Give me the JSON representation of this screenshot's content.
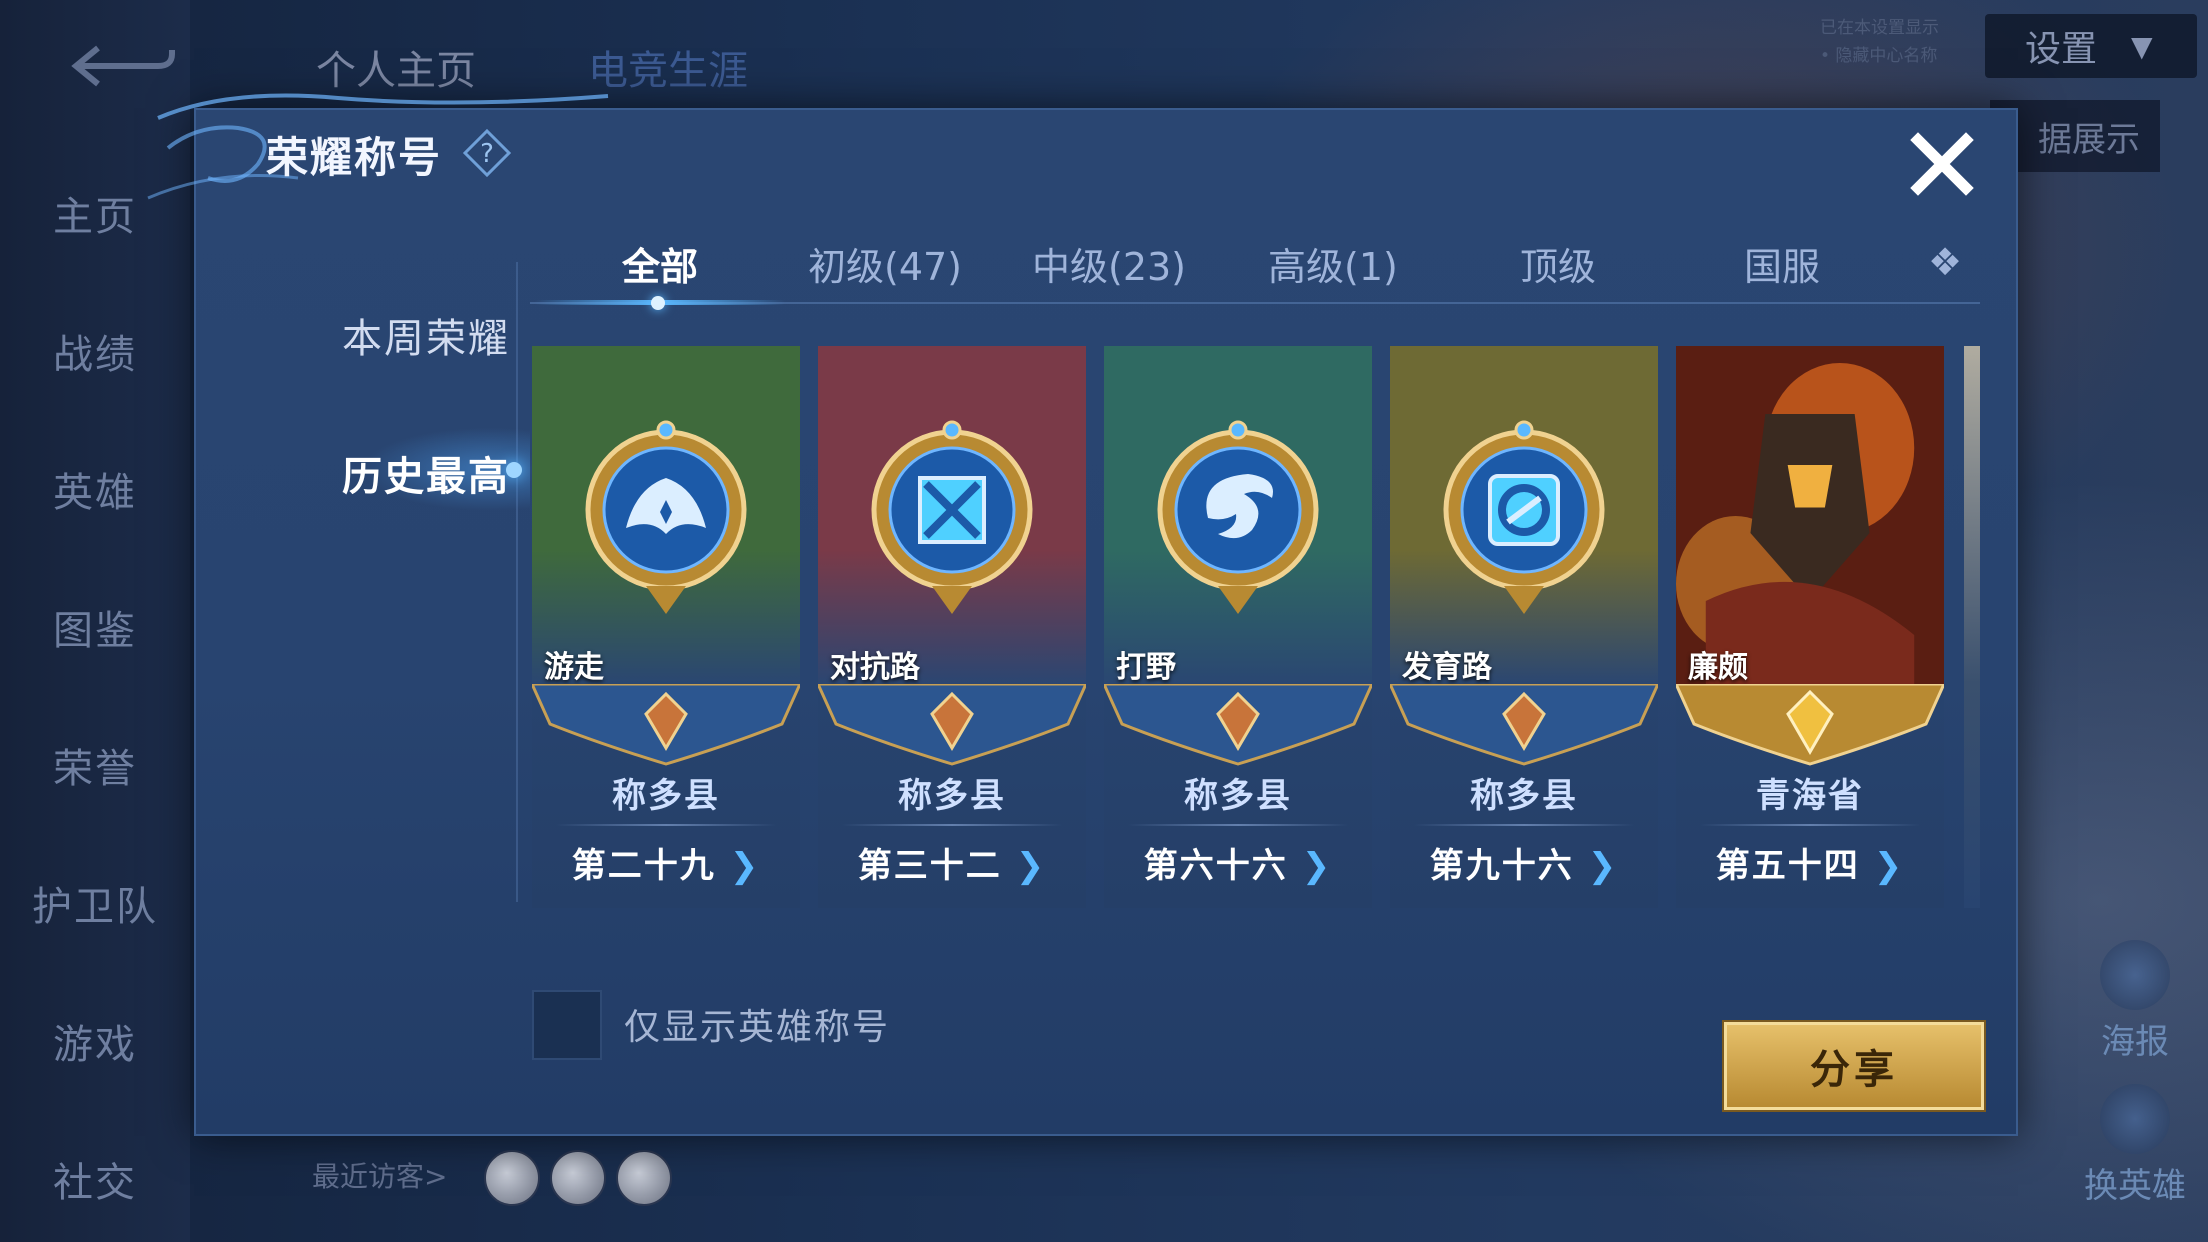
{
  "background": {
    "nav_items": [
      "主页",
      "战绩",
      "英雄",
      "图鉴",
      "荣誉",
      "护卫队",
      "游戏",
      "社交"
    ],
    "top_tabs": [
      "个人主页",
      "电竞生涯"
    ],
    "settings_label": "设置",
    "record_hint_line1": "已在本设置显示",
    "record_hint_line2": "• 隐藏中心名称",
    "data_show_label": "据展示",
    "recent_visitors_label": "最近访客>",
    "right_actions": [
      "海报",
      "换英雄"
    ]
  },
  "dialog": {
    "title": "荣耀称号",
    "left_tabs": {
      "week": "本周荣耀",
      "history": "历史最高"
    },
    "filter_tabs": [
      "全部",
      "初级(47)",
      "中级(23)",
      "高级(1)",
      "顶级",
      "国服"
    ],
    "active_filter": "全部",
    "titles": [
      {
        "position": "游走",
        "region": "称多县",
        "rank": "第二十九",
        "art_color": "#3f6a3c"
      },
      {
        "position": "对抗路",
        "region": "称多县",
        "rank": "第三十二",
        "art_color": "#7a3a48"
      },
      {
        "position": "打野",
        "region": "称多县",
        "rank": "第六十六",
        "art_color": "#2f6a62"
      },
      {
        "position": "发育路",
        "region": "称多县",
        "rank": "第九十六",
        "art_color": "#6e6a34"
      },
      {
        "position": "廉颇",
        "region": "青海省",
        "rank": "第五十四",
        "art_color": "#8a3a1c"
      }
    ],
    "checkbox_label": "仅显示英雄称号",
    "share_label": "分享"
  },
  "icons": [
    "back-arrow-icon",
    "help-icon",
    "close-icon",
    "wings-emblem-icon",
    "crossed-swords-emblem-icon",
    "dragon-emblem-icon",
    "arrow-emblem-icon",
    "hero-portrait",
    "chevron-right-icon"
  ]
}
